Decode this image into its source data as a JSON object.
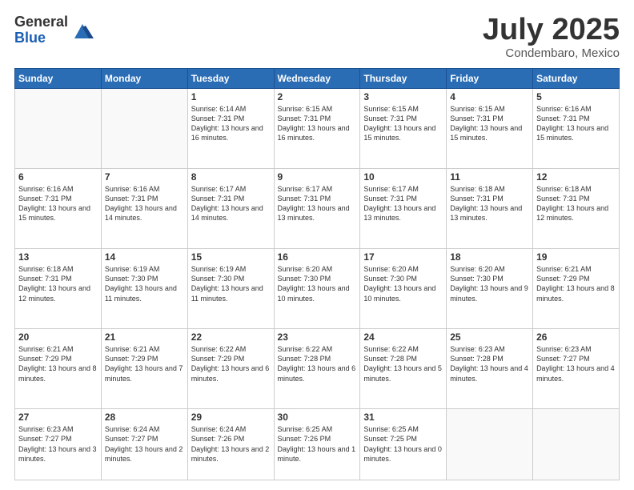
{
  "header": {
    "logo_general": "General",
    "logo_blue": "Blue",
    "month_title": "July 2025",
    "location": "Condembaro, Mexico"
  },
  "days_of_week": [
    "Sunday",
    "Monday",
    "Tuesday",
    "Wednesday",
    "Thursday",
    "Friday",
    "Saturday"
  ],
  "weeks": [
    [
      {
        "day": "",
        "info": ""
      },
      {
        "day": "",
        "info": ""
      },
      {
        "day": "1",
        "info": "Sunrise: 6:14 AM\nSunset: 7:31 PM\nDaylight: 13 hours and 16 minutes."
      },
      {
        "day": "2",
        "info": "Sunrise: 6:15 AM\nSunset: 7:31 PM\nDaylight: 13 hours and 16 minutes."
      },
      {
        "day": "3",
        "info": "Sunrise: 6:15 AM\nSunset: 7:31 PM\nDaylight: 13 hours and 15 minutes."
      },
      {
        "day": "4",
        "info": "Sunrise: 6:15 AM\nSunset: 7:31 PM\nDaylight: 13 hours and 15 minutes."
      },
      {
        "day": "5",
        "info": "Sunrise: 6:16 AM\nSunset: 7:31 PM\nDaylight: 13 hours and 15 minutes."
      }
    ],
    [
      {
        "day": "6",
        "info": "Sunrise: 6:16 AM\nSunset: 7:31 PM\nDaylight: 13 hours and 15 minutes."
      },
      {
        "day": "7",
        "info": "Sunrise: 6:16 AM\nSunset: 7:31 PM\nDaylight: 13 hours and 14 minutes."
      },
      {
        "day": "8",
        "info": "Sunrise: 6:17 AM\nSunset: 7:31 PM\nDaylight: 13 hours and 14 minutes."
      },
      {
        "day": "9",
        "info": "Sunrise: 6:17 AM\nSunset: 7:31 PM\nDaylight: 13 hours and 13 minutes."
      },
      {
        "day": "10",
        "info": "Sunrise: 6:17 AM\nSunset: 7:31 PM\nDaylight: 13 hours and 13 minutes."
      },
      {
        "day": "11",
        "info": "Sunrise: 6:18 AM\nSunset: 7:31 PM\nDaylight: 13 hours and 13 minutes."
      },
      {
        "day": "12",
        "info": "Sunrise: 6:18 AM\nSunset: 7:31 PM\nDaylight: 13 hours and 12 minutes."
      }
    ],
    [
      {
        "day": "13",
        "info": "Sunrise: 6:18 AM\nSunset: 7:31 PM\nDaylight: 13 hours and 12 minutes."
      },
      {
        "day": "14",
        "info": "Sunrise: 6:19 AM\nSunset: 7:30 PM\nDaylight: 13 hours and 11 minutes."
      },
      {
        "day": "15",
        "info": "Sunrise: 6:19 AM\nSunset: 7:30 PM\nDaylight: 13 hours and 11 minutes."
      },
      {
        "day": "16",
        "info": "Sunrise: 6:20 AM\nSunset: 7:30 PM\nDaylight: 13 hours and 10 minutes."
      },
      {
        "day": "17",
        "info": "Sunrise: 6:20 AM\nSunset: 7:30 PM\nDaylight: 13 hours and 10 minutes."
      },
      {
        "day": "18",
        "info": "Sunrise: 6:20 AM\nSunset: 7:30 PM\nDaylight: 13 hours and 9 minutes."
      },
      {
        "day": "19",
        "info": "Sunrise: 6:21 AM\nSunset: 7:29 PM\nDaylight: 13 hours and 8 minutes."
      }
    ],
    [
      {
        "day": "20",
        "info": "Sunrise: 6:21 AM\nSunset: 7:29 PM\nDaylight: 13 hours and 8 minutes."
      },
      {
        "day": "21",
        "info": "Sunrise: 6:21 AM\nSunset: 7:29 PM\nDaylight: 13 hours and 7 minutes."
      },
      {
        "day": "22",
        "info": "Sunrise: 6:22 AM\nSunset: 7:29 PM\nDaylight: 13 hours and 6 minutes."
      },
      {
        "day": "23",
        "info": "Sunrise: 6:22 AM\nSunset: 7:28 PM\nDaylight: 13 hours and 6 minutes."
      },
      {
        "day": "24",
        "info": "Sunrise: 6:22 AM\nSunset: 7:28 PM\nDaylight: 13 hours and 5 minutes."
      },
      {
        "day": "25",
        "info": "Sunrise: 6:23 AM\nSunset: 7:28 PM\nDaylight: 13 hours and 4 minutes."
      },
      {
        "day": "26",
        "info": "Sunrise: 6:23 AM\nSunset: 7:27 PM\nDaylight: 13 hours and 4 minutes."
      }
    ],
    [
      {
        "day": "27",
        "info": "Sunrise: 6:23 AM\nSunset: 7:27 PM\nDaylight: 13 hours and 3 minutes."
      },
      {
        "day": "28",
        "info": "Sunrise: 6:24 AM\nSunset: 7:27 PM\nDaylight: 13 hours and 2 minutes."
      },
      {
        "day": "29",
        "info": "Sunrise: 6:24 AM\nSunset: 7:26 PM\nDaylight: 13 hours and 2 minutes."
      },
      {
        "day": "30",
        "info": "Sunrise: 6:25 AM\nSunset: 7:26 PM\nDaylight: 13 hours and 1 minute."
      },
      {
        "day": "31",
        "info": "Sunrise: 6:25 AM\nSunset: 7:25 PM\nDaylight: 13 hours and 0 minutes."
      },
      {
        "day": "",
        "info": ""
      },
      {
        "day": "",
        "info": ""
      }
    ]
  ]
}
